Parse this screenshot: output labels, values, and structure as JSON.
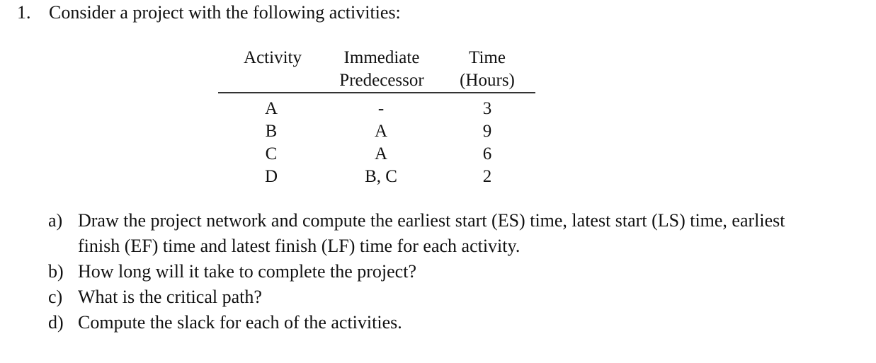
{
  "question": {
    "number": "1.",
    "prompt": "Consider a project with the following activities:"
  },
  "table": {
    "headers": {
      "activity": "Activity",
      "predecessor_line1": "Immediate",
      "predecessor_line2": "Predecessor",
      "time_line1": "Time",
      "time_line2": "(Hours)"
    },
    "rows": [
      {
        "activity": "A",
        "predecessor": "-",
        "time": "3"
      },
      {
        "activity": "B",
        "predecessor": "A",
        "time": "9"
      },
      {
        "activity": "C",
        "predecessor": "A",
        "time": "6"
      },
      {
        "activity": "D",
        "predecessor": "B, C",
        "time": "2"
      }
    ]
  },
  "parts": [
    {
      "label": "a)",
      "text": "Draw the project network and compute the earliest start (ES) time, latest start (LS) time, earliest finish (EF) time and latest finish (LF) time for each activity."
    },
    {
      "label": "b)",
      "text": "How long will it take to complete the project?"
    },
    {
      "label": "c)",
      "text": "What is the critical path?"
    },
    {
      "label": "d)",
      "text": "Compute the slack for each of the activities."
    }
  ]
}
